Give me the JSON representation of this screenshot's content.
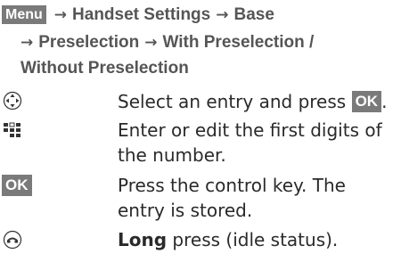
{
  "nav": {
    "menu_key": "Menu",
    "arrow": "→",
    "items": [
      "Handset Settings",
      "Base",
      "Preselection",
      "With Preselection /",
      "Without Preselection"
    ]
  },
  "steps": [
    {
      "icon": "control-key-icon",
      "text": "Select an entry and press ",
      "key": "OK",
      "after": "."
    },
    {
      "icon": "keypad-icon",
      "text": "Enter or edit the first digits of the number."
    },
    {
      "icon": "ok-key",
      "key": "OK",
      "text": "Press the control key. The entry is stored."
    },
    {
      "icon": "end-call-key-icon",
      "bold": "Long",
      "text": " press (idle status)."
    }
  ]
}
